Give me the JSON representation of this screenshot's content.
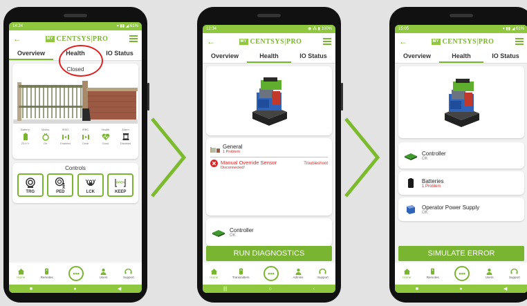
{
  "colors": {
    "accent": "#79b530",
    "statusbar": "#8fc73e",
    "error": "#d62828",
    "highlight_circle": "#e02020"
  },
  "app": {
    "logo_prefix": "MY",
    "logo_text": "CENTSYS|PRO"
  },
  "phones": [
    {
      "time": "14:24",
      "status_icons": "▾ ▮▮ ◢ 61%",
      "tabs": [
        "Overview",
        "Health",
        "IO Status"
      ],
      "active_tab": 0,
      "gate": {
        "title": "Closed",
        "indicators": [
          {
            "label": "Battery",
            "value": "23.9 V",
            "icon": "battery-icon"
          },
          {
            "label": "Mains",
            "value": "On",
            "icon": "mains-plug-icon"
          },
          {
            "label": "IRSO",
            "value": "Enabled",
            "icon": "irso-beam-icon"
          },
          {
            "label": "IRBC",
            "value": "Clear",
            "icon": "irbc-beam-icon"
          },
          {
            "label": "Health",
            "value": "Good",
            "icon": "heart-pulse-icon"
          },
          {
            "label": "Alarm",
            "value": "Disabled",
            "icon": "alarm-bell-icon"
          }
        ]
      },
      "controls": {
        "title": "Controls",
        "buttons": [
          {
            "label": "TRG",
            "icon": "trigger-icon"
          },
          {
            "label": "PED",
            "icon": "pedestrian-icon"
          },
          {
            "label": "LCK",
            "icon": "lock-icon"
          },
          {
            "label": "KEEP",
            "icon": "keep-open-icon",
            "badge": "OPEN"
          }
        ]
      },
      "nav": [
        "Home",
        "Remotes",
        "Users",
        "Support"
      ]
    },
    {
      "time": "12:34",
      "status_icons": "◉ ⁂ ▮ 100%",
      "tabs": [
        "Overview",
        "Health",
        "IO Status"
      ],
      "active_tab": 1,
      "general": {
        "title": "General",
        "problems": "1 Problem",
        "sensor": "Manual Override Sensor",
        "sensor_status": "Disconnected!",
        "troubleshoot": "Troubleshoot"
      },
      "controller": {
        "name": "Controller",
        "status": "OK"
      },
      "action": "RUN DIAGNOSTICS",
      "nav": [
        "Home",
        "Transmitters",
        "Admins",
        "Support"
      ]
    },
    {
      "time": "15:05",
      "status_icons": "▾ ▮▮ ◢ 61%",
      "tabs": [
        "Overview",
        "Health",
        "IO Status"
      ],
      "active_tab": 1,
      "items": [
        {
          "name": "Controller",
          "status": "OK",
          "error": false,
          "icon": "controller-board-icon"
        },
        {
          "name": "Batteries",
          "status": "1 Problem",
          "error": true,
          "icon": "battery-pack-icon"
        },
        {
          "name": "Operator Power Supply",
          "status": "OK",
          "error": false,
          "icon": "power-supply-icon"
        }
      ],
      "action": "SIMULATE ERROR",
      "nav": [
        "Home",
        "Remotes",
        "Users",
        "Support"
      ]
    }
  ]
}
